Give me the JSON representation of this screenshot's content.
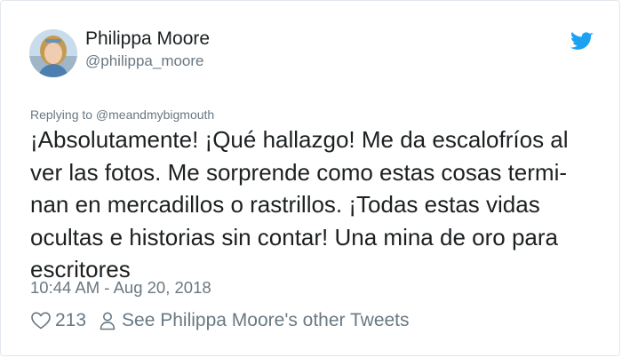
{
  "author": {
    "name": "Philippa Moore",
    "handle": "@philippa_moore"
  },
  "reply_context": "Replying to @meandmybigmouth",
  "tweet": {
    "lines": [
      "¡Absolutamente! ¡Qué hallazgo! Me da escalofríos al",
      "ver las fotos. Me sorprende como estas cosas termi-",
      "nan en mercadillos o rastrillos. ¡Todas estas vidas",
      "ocultas e historias sin contar! Una mina de oro para",
      "escritores"
    ]
  },
  "timestamp": "10:44 AM - Aug 20, 2018",
  "actions": {
    "like_count": "213",
    "other_tweets_label": "See Philippa Moore's other Tweets"
  },
  "icons": {
    "brand": "twitter-bird-icon",
    "like": "heart-icon",
    "profile": "person-icon"
  },
  "colors": {
    "brand": "#1da1f2",
    "text": "#1c2022",
    "secondary_text": "#697882",
    "border": "#e1e8ed"
  }
}
